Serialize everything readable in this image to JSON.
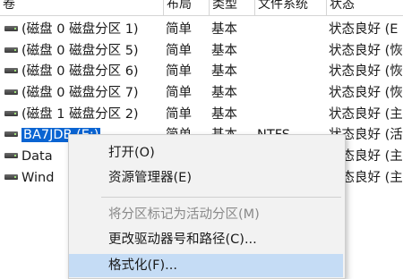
{
  "columns": {
    "volume": "卷",
    "layout": "布局",
    "type": "类型",
    "filesystem": "文件系统",
    "status": "状态"
  },
  "volumes": [
    {
      "name": "(磁盘 0 磁盘分区 1)",
      "layout": "简单",
      "type": "基本",
      "filesystem": "",
      "status": "状态良好 (E"
    },
    {
      "name": "(磁盘 0 磁盘分区 5)",
      "layout": "简单",
      "type": "基本",
      "filesystem": "",
      "status": "状态良好 (恢"
    },
    {
      "name": "(磁盘 0 磁盘分区 6)",
      "layout": "简单",
      "type": "基本",
      "filesystem": "",
      "status": "状态良好 (恢"
    },
    {
      "name": "(磁盘 0 磁盘分区 7)",
      "layout": "简单",
      "type": "基本",
      "filesystem": "",
      "status": "状态良好 (恢"
    },
    {
      "name": "(磁盘 1 磁盘分区 2)",
      "layout": "简单",
      "type": "基本",
      "filesystem": "",
      "status": "状态良好 (主"
    },
    {
      "name": "BA7JDB (E:)",
      "layout": "简单",
      "type": "基本",
      "filesystem": "NTFS",
      "status": "状态良好 (活"
    },
    {
      "name": "Data",
      "layout": "",
      "type": "",
      "filesystem": "",
      "status": "状态良好 (主"
    },
    {
      "name": "Wind",
      "layout": "",
      "type": "",
      "filesystem": "",
      "status": "状态良好 (主"
    }
  ],
  "context_menu": {
    "open": "打开(O)",
    "explorer": "资源管理器(E)",
    "mark_active": "将分区标记为活动分区(M)",
    "change_letter": "更改驱动器号和路径(C)...",
    "format": "格式化(F)..."
  },
  "colors": {
    "selection": "#0a64d2",
    "menu_hover": "#c5dcf5",
    "menu_bg": "#f2f2f2"
  },
  "icons": {
    "volume_row": "drive-icon"
  }
}
